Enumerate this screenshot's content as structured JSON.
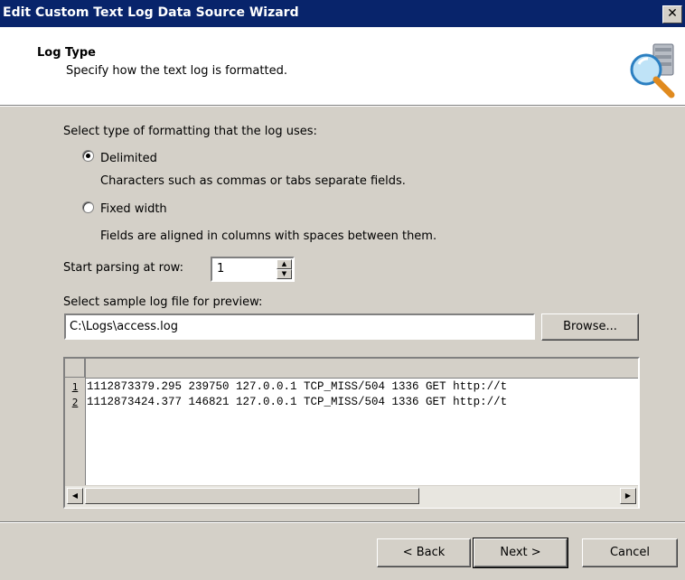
{
  "window": {
    "title": "Edit Custom Text Log Data Source Wizard",
    "close_glyph": "✕"
  },
  "header": {
    "title": "Log Type",
    "subtitle": "Specify how the text log is formatted.",
    "icon": "log-search-icon"
  },
  "format": {
    "prompt": "Select type of formatting that the log uses:",
    "options": [
      {
        "label": "Delimited",
        "description": "Characters such as commas or tabs separate fields.",
        "selected": true
      },
      {
        "label": "Fixed width",
        "description": "Fields are aligned in columns with spaces between them.",
        "selected": false
      }
    ]
  },
  "parsing": {
    "label": "Start parsing at row:",
    "value": "1"
  },
  "sample": {
    "label": "Select sample log file for preview:",
    "path": "C:\\Logs\\access.log",
    "browse_label": "Browse..."
  },
  "preview": {
    "rows": [
      {
        "num": "1",
        "text": "1112873379.295 239750 127.0.0.1 TCP_MISS/504 1336 GET http://t"
      },
      {
        "num": "2",
        "text": "1112873424.377 146821 127.0.0.1 TCP_MISS/504 1336 GET http://t"
      }
    ]
  },
  "footer": {
    "back_label": "< Back",
    "next_label": "Next >",
    "cancel_label": "Cancel"
  },
  "colors": {
    "titlebar": "#08246b",
    "dialog": "#d4d0c8"
  }
}
